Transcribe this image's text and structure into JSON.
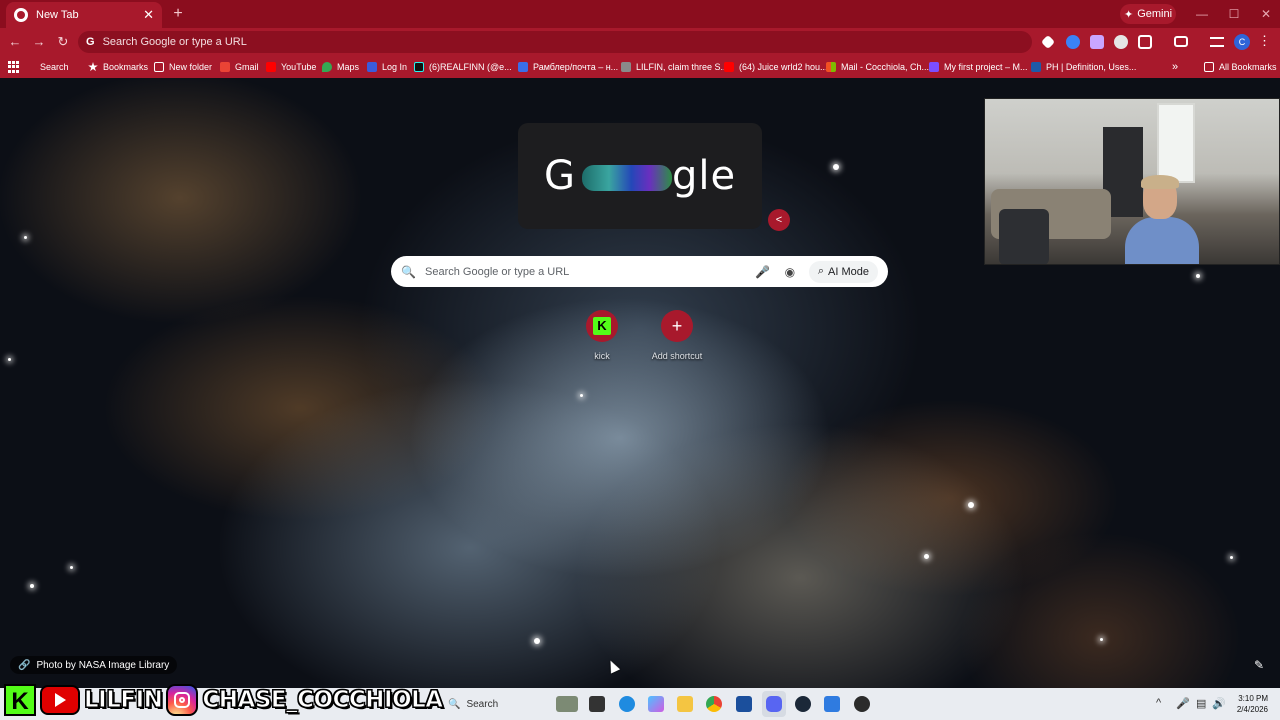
{
  "tab": {
    "title": "New Tab",
    "close": "✕",
    "new_tab": "+"
  },
  "gemini": {
    "label": "Gemini",
    "icon": "sparkle-icon"
  },
  "window_controls": {
    "minimize": "—",
    "maximize": "☐",
    "close": "✕"
  },
  "toolbar": {
    "back": "←",
    "forward": "→",
    "reload": "↻",
    "omnibox_placeholder": "Search Google or type a URL",
    "profile_initial": "C",
    "menu": "⋮"
  },
  "bookmarks": {
    "items": [
      {
        "label": "Search",
        "icon": "search-icon",
        "color": "#ffffff"
      },
      {
        "label": "Bookmarks",
        "icon": "star-icon",
        "color": "#ffffff"
      },
      {
        "label": "New folder",
        "icon": "folder-icon",
        "color": "#ffffff"
      },
      {
        "label": "Gmail",
        "icon": "gmail-icon",
        "color": "#ea4335"
      },
      {
        "label": "YouTube",
        "icon": "youtube-icon",
        "color": "#ff0000"
      },
      {
        "label": "Maps",
        "icon": "maps-icon",
        "color": "#34a853"
      },
      {
        "label": "Log In",
        "icon": "login-icon",
        "color": "#3b5bdb"
      },
      {
        "label": "(6)REALFINN (@e...",
        "icon": "tiktok-icon",
        "color": "#111111"
      },
      {
        "label": "Рамблер/почта – н...",
        "icon": "mail-icon",
        "color": "#3b6ee8"
      },
      {
        "label": "LILFIN, claim three S...",
        "icon": "game-icon",
        "color": "#8a8a8a"
      },
      {
        "label": "(64) Juice wrld2 hou...",
        "icon": "youtube-icon",
        "color": "#ff0000"
      },
      {
        "label": "Mail - Cocchiola, Ch...",
        "icon": "microsoft-icon",
        "color": "#f25022"
      },
      {
        "label": "My first project – M...",
        "icon": "project-icon",
        "color": "#7c4dff"
      },
      {
        "label": "PH | Definition, Uses...",
        "icon": "britannica-icon",
        "color": "#1e5aa8"
      }
    ],
    "more": "»",
    "all_bookmarks": "All Bookmarks"
  },
  "ntp": {
    "doodle_text_left": "G",
    "doodle_text_right": "gle",
    "share": "<",
    "search_placeholder": "Search Google or type a URL",
    "ai_mode": "AI Mode",
    "shortcuts": [
      {
        "label": "kick",
        "icon": "kick-icon"
      },
      {
        "label": "Add shortcut",
        "icon": "plus-icon"
      }
    ],
    "credit": "Photo by NASA Image Library"
  },
  "taskbar": {
    "search": "Search",
    "time": "3:10 PM",
    "date": "2/4/2026",
    "tray_caret": "^"
  },
  "branding": {
    "kick_letter": "K",
    "youtube_name": "LILFIN",
    "instagram_name": "CHASE_COCCHIOLA"
  }
}
